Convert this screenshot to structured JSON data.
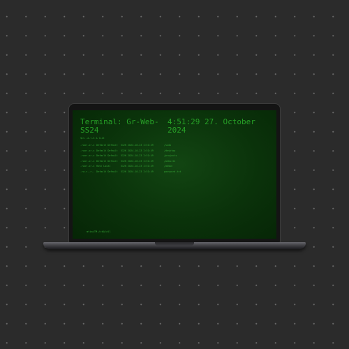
{
  "terminal": {
    "title_name": "Terminal: Gr-Web-SS24",
    "title_time": "4:51:29 27. October 2024",
    "prompt_command": "$ls -a-l-h & list",
    "bottom_prompt": "mtiaiTM:/ckA/all"
  },
  "listing": [
    {
      "perm": "-rwxr-xr-x",
      "owner": "Default Default",
      "size": "512K",
      "date": "2024-10-23 2:51:49",
      "name": "/sudo"
    },
    {
      "perm": "-rwxr-xr-x",
      "owner": "Default Default",
      "size": "512K",
      "date": "2024-10-23 2:51:49",
      "name": "/desktop"
    },
    {
      "perm": "-rwxr-xr-x",
      "owner": "Default Default",
      "size": "512K",
      "date": "2024-10-23 2:51:49",
      "name": "/projects"
    },
    {
      "perm": "-rwxr-xr-x",
      "owner": "Default Default",
      "size": "512K",
      "date": "2024-10-23 2:51:49",
      "name": "/website"
    },
    {
      "perm": "-rwxr-xr-x",
      "owner": "Host Local",
      "size": "512K",
      "date": "2024-10-23 2:51:49",
      "name": "/admin"
    },
    {
      "perm": "-rw-r--r--",
      "owner": "Default Default",
      "size": "512K",
      "date": "2024-10-23 2:51:49",
      "name": "password.txt"
    }
  ]
}
